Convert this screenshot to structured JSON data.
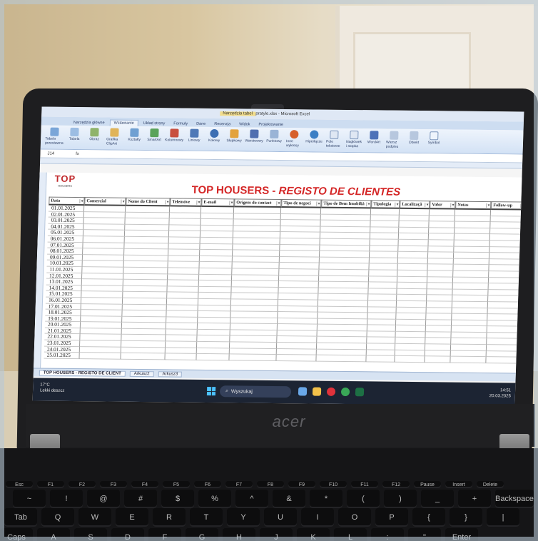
{
  "window": {
    "title": "pratyle.xlsx - Microsoft Excel",
    "context_tab": "Narzędzia tabel",
    "tabs": [
      "Narzędzia główne",
      "Wstawianie",
      "Układ strony",
      "Formuły",
      "Dane",
      "Recenzja",
      "Widok",
      "Projektowanie"
    ],
    "active_tab": "Wstawianie",
    "name_box": "J14"
  },
  "ribbon": {
    "buttons": [
      "Tabela przestawna",
      "Tabela",
      "Obraz",
      "Grafika ClipArt",
      "Kształty",
      "SmartArt",
      "Kolumnowy",
      "Liniowy",
      "Kołowy",
      "Słupkowy",
      "Warstwowy",
      "Punktowy",
      "Inne wykresy",
      "Hiperłącze",
      "Pole tekstowe",
      "Nagłówek i stopka",
      "WordArt",
      "Wiersz podpisu",
      "Obiekt",
      "Symbol"
    ]
  },
  "sheet": {
    "logo_top": "TOP",
    "logo_bottom": "HOUSERS",
    "title_part1": "TOP HOUSERS",
    "title_sep": " - ",
    "title_part2": "REGISTO DE CLIENTES",
    "headers": [
      "Data",
      "Comercial",
      "Nome do Client",
      "Telemóve",
      "E-mail",
      "Origem do contact",
      "Tipo de negoci",
      "Tipo de Bem Imobiliá",
      "Tipologia",
      "Localizaçã",
      "Valor",
      "Notas",
      "Follow-up"
    ],
    "dates": [
      "01.01.2025",
      "02.01.2025",
      "03.01.2025",
      "04.01.2025",
      "05.01.2025",
      "06.01.2025",
      "07.01.2025",
      "08.01.2025",
      "09.01.2025",
      "10.01.2025",
      "11.01.2025",
      "12.01.2025",
      "13.01.2025",
      "14.01.2025",
      "15.01.2025",
      "16.01.2025",
      "17.01.2025",
      "18.01.2025",
      "19.01.2025",
      "20.01.2025",
      "21.01.2025",
      "22.01.2025",
      "23.01.2025",
      "24.01.2025",
      "25.01.2025"
    ],
    "tabs": [
      "TOP HOUSERS - REGISTO DE CLIENT",
      "Arkusz2",
      "Arkusz3"
    ]
  },
  "taskbar": {
    "temperature": "17°C",
    "weather": "Lekki deszcz",
    "search": "Wyszukaj",
    "time": "14:51",
    "date": "20.03.2025"
  },
  "laptop": {
    "brand": "acer"
  },
  "keyboard": {
    "row1": [
      "Esc",
      "F1",
      "F2",
      "F3",
      "F4",
      "F5",
      "F6",
      "F7",
      "F8",
      "F9",
      "F10",
      "F11",
      "F12",
      "Pause",
      "Insert",
      "Delete"
    ],
    "row2": [
      "~",
      "!",
      "@",
      "#",
      "$",
      "%",
      "^",
      "&",
      "*",
      "(",
      ")",
      "_",
      "+",
      "Backspace"
    ],
    "row3": [
      "Tab",
      "Q",
      "W",
      "E",
      "R",
      "T",
      "Y",
      "U",
      "I",
      "O",
      "P",
      "{",
      "}",
      "|"
    ],
    "row4": [
      "Caps",
      "A",
      "S",
      "D",
      "F",
      "G",
      "H",
      "J",
      "K",
      "L",
      ":",
      "\"",
      "Enter"
    ]
  }
}
